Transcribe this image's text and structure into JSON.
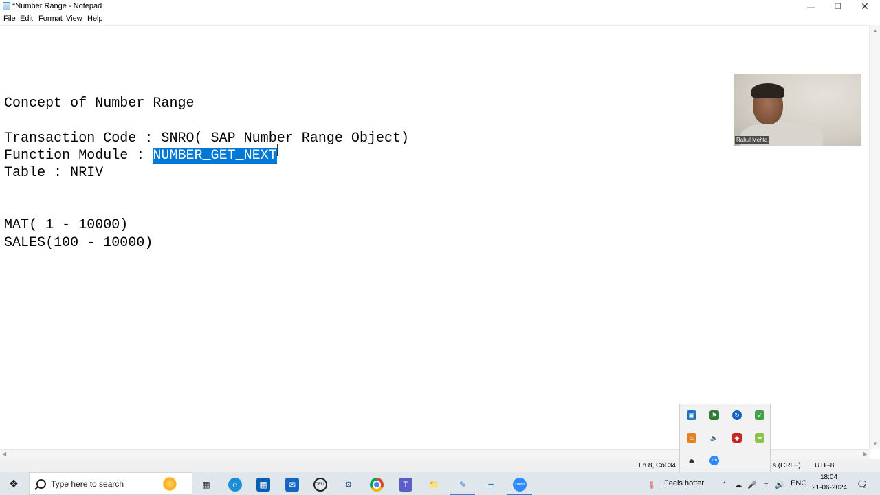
{
  "window": {
    "title": "*Number Range - Notepad",
    "minimize_icon": "minimize-icon",
    "maximize_icon": "restore-icon",
    "close_icon": "close-icon"
  },
  "menu": {
    "file": "File",
    "edit": "Edit",
    "format": "Format",
    "view": "View",
    "help": "Help"
  },
  "document": {
    "line1": "Concept of Number Range",
    "line2": "Transaction Code : SNRO( SAP Number Range Object)",
    "line3_prefix": "Function Module : ",
    "line3_selected": "NUMBER_GET_NEXT",
    "line4": "Table : NRIV",
    "line5": "MAT( 1 - 10000)",
    "line6": "SALES(100 - 10000)"
  },
  "status": {
    "position": "Ln 8, Col 34",
    "line_ending": "s (CRLF)",
    "encoding": "UTF-8"
  },
  "video": {
    "participant_name": "Rahul Mehta"
  },
  "taskbar": {
    "search_placeholder": "Type here to search",
    "weather_text": "Feels hotter",
    "language": "ENG",
    "time": "18:04",
    "date": "21-06-2024",
    "notification_count": "4"
  },
  "colors": {
    "selection": "#0078d7",
    "taskbar": "#dfe6ec"
  }
}
